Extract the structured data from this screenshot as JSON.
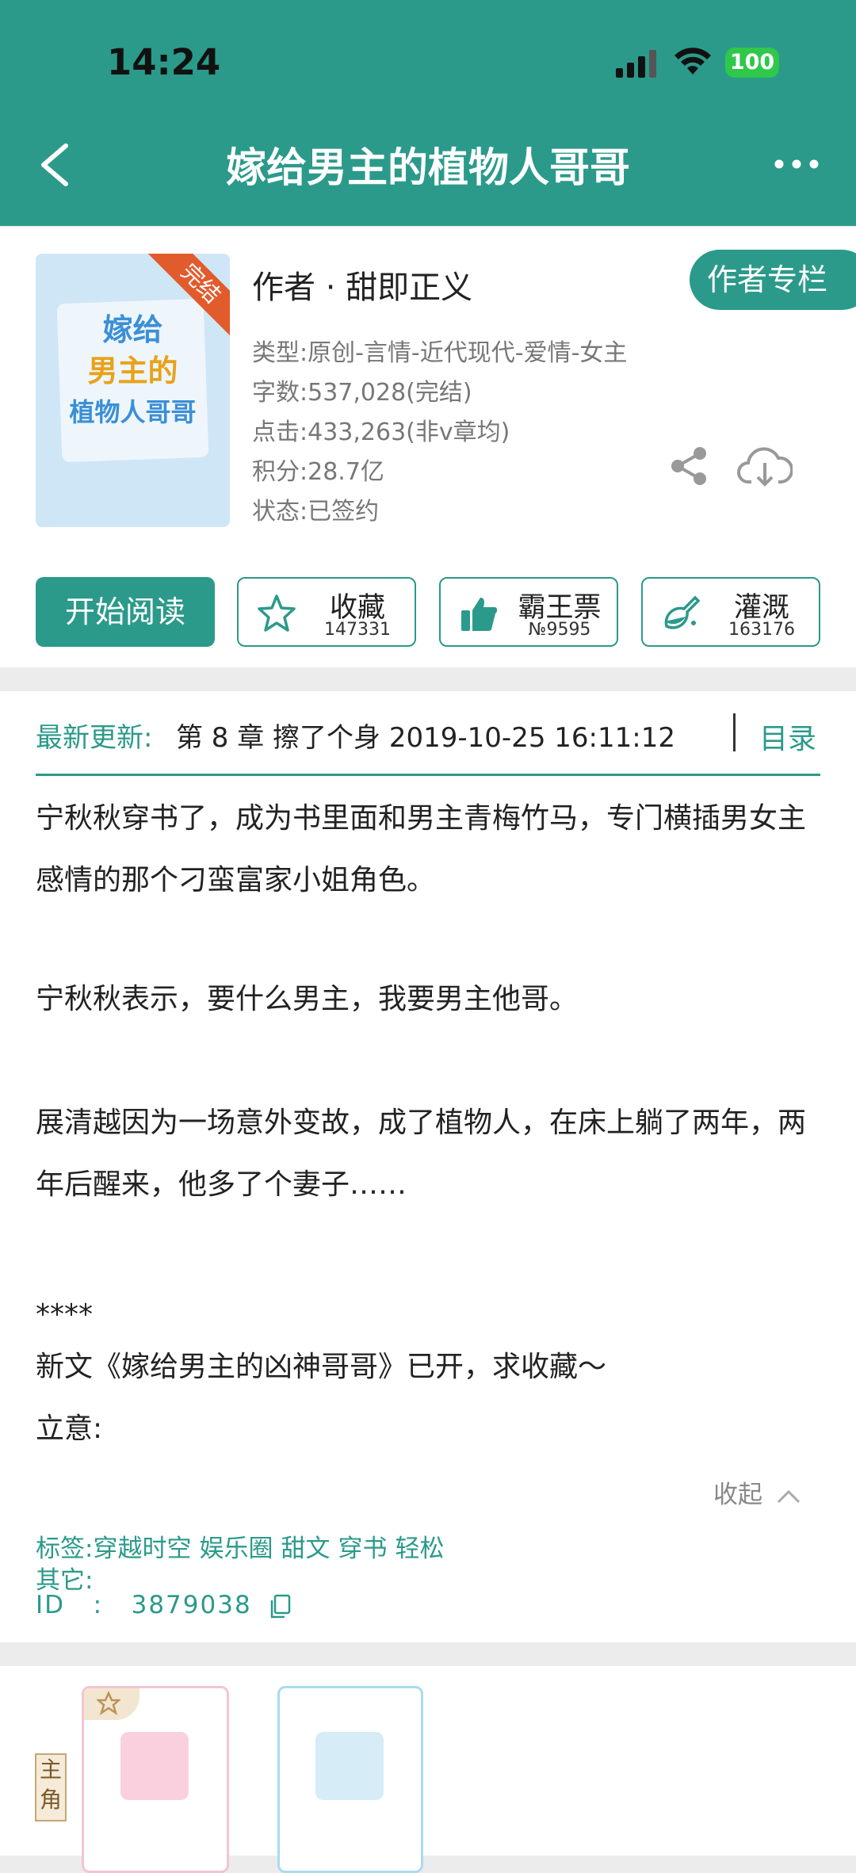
{
  "status_bar": {
    "time": "14:24",
    "battery": "100"
  },
  "header": {
    "title": "嫁给男主的植物人哥哥"
  },
  "book": {
    "cover_title_lines": [
      "嫁给",
      "男主的",
      "植物人哥哥"
    ],
    "cover_badge": "完结",
    "author_line": "作者 · 甜即正义",
    "author_column_label": "作者专栏",
    "meta": [
      "类型:原创-言情-近代现代-爱情-女主",
      "字数:537,028(完结)",
      "点击:433,263(非v章均)",
      "积分:28.7亿",
      "状态:已签约"
    ]
  },
  "actions": {
    "read_label": "开始阅读",
    "collect": {
      "label": "收藏",
      "count": "147331"
    },
    "ticket": {
      "label": "霸王票",
      "count": "№9595"
    },
    "water": {
      "label": "灌溉",
      "count": "163176"
    }
  },
  "latest": {
    "label": "最新更新:",
    "value": "第 8 章 擦了个身 2019-10-25 16:11:12",
    "toc_label": "目录"
  },
  "synopsis": [
    "宁秋秋穿书了，成为书里面和男主青梅竹马，专门横插男女主感情的那个刁蛮富家小姐角色。",
    "宁秋秋表示，要什么男主，我要男主他哥。",
    "展清越因为一场意外变故，成了植物人，在床上躺了两年，两年后醒来，他多了个妻子……",
    "****",
    "新文《嫁给男主的凶神哥哥》已开，求收藏～",
    "立意:"
  ],
  "collapse_label": "收起",
  "tags": {
    "label": "标签:",
    "items": [
      "穿越时空",
      "娱乐圈",
      "甜文",
      "穿书",
      "轻松"
    ]
  },
  "other_label": "其它:",
  "id_row": {
    "label": "ID",
    "value": "3879038"
  },
  "roles": {
    "badge": "主角"
  },
  "colors": {
    "accent": "#2b9a8a",
    "ribbon": "#e25b2c",
    "battery": "#2fc84a"
  }
}
